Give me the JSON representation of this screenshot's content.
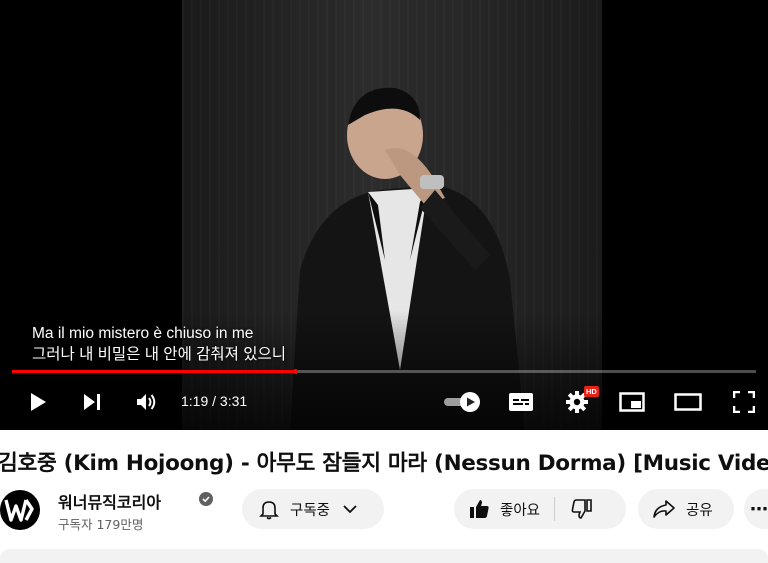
{
  "player": {
    "caption_line1": "Ma il mio mistero è chiuso in me",
    "caption_line2": "그러나 내 비밀은 내 안에 감춰져 있으니",
    "time": "1:19 / 3:31",
    "progress_fraction": 0.38,
    "hd_badge": "HD",
    "accent_color": "#ff0000"
  },
  "video": {
    "title": "김호중 (Kim Hojoong) - 아무도 잠들지 마라 (Nessun Dorma) [Music Video]"
  },
  "channel": {
    "name": "워너뮤직코리아",
    "subscribers": "구독자 179만명",
    "logo_icon": "warner-music-logo"
  },
  "actions": {
    "subscribe_label": "구독중",
    "like_label": "좋아요",
    "share_label": "공유",
    "more_label": "⋯"
  }
}
